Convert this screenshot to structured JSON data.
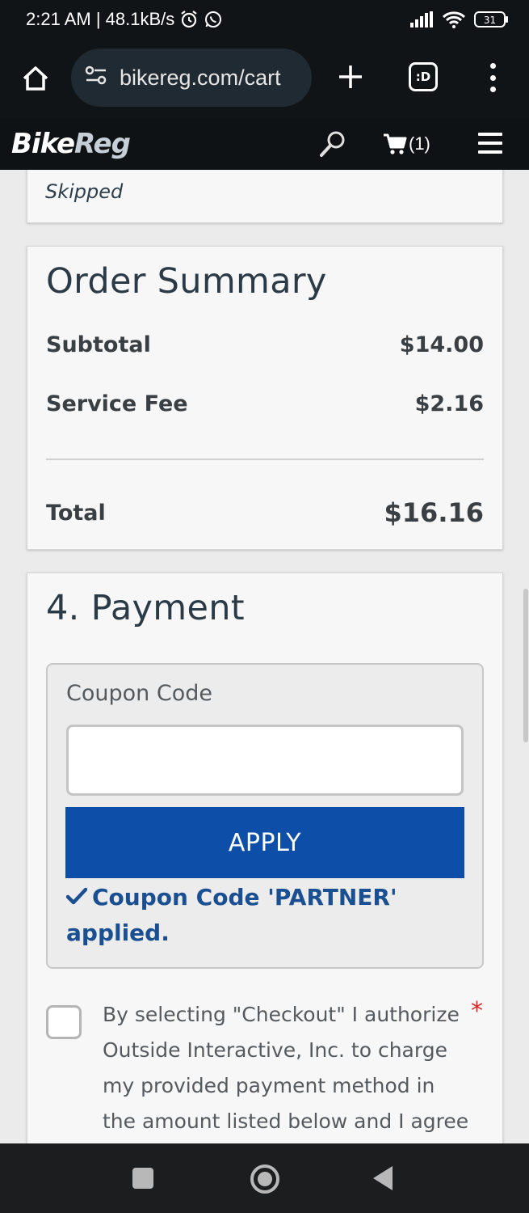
{
  "status_bar": {
    "time_speed": "2:21 AM | 48.1kB/s",
    "battery": "31",
    "icons": [
      "alarm-icon",
      "whatsapp-icon",
      "signal-icon",
      "wifi-icon",
      "battery-icon"
    ]
  },
  "browser": {
    "url": "bikereg.com/cart",
    "tabs_label": ":D",
    "icons": [
      "home-icon",
      "site-settings-icon",
      "plus-icon",
      "tabs-icon",
      "more-vert-icon"
    ]
  },
  "site_header": {
    "logo_part1": "Bike",
    "logo_part2": "Reg",
    "cart_count": "(1)",
    "icons": [
      "search-icon",
      "cart-icon",
      "hamburger-menu-icon"
    ]
  },
  "skipped_card": {
    "text": "Skipped"
  },
  "order_summary": {
    "title": "Order Summary",
    "subtotal_label": "Subtotal",
    "subtotal_value": "$14.00",
    "fee_label": "Service Fee",
    "fee_value": "$2.16",
    "total_label": "Total",
    "total_value": "$16.16"
  },
  "payment": {
    "title": "4. Payment",
    "coupon_label": "Coupon Code",
    "coupon_value": "",
    "apply_label": "APPLY",
    "applied_message": "Coupon Code 'PARTNER' applied.",
    "consent_text": "By selecting \"Checkout\" I authorize Outside Interactive, Inc. to charge my provided payment method in the amount listed below and I agree to",
    "required_mark": "*"
  },
  "colors": {
    "accent": "#0d4fa8",
    "success_text": "#1a4f92",
    "required": "#d9242a",
    "header_bg": "#0f1214"
  }
}
